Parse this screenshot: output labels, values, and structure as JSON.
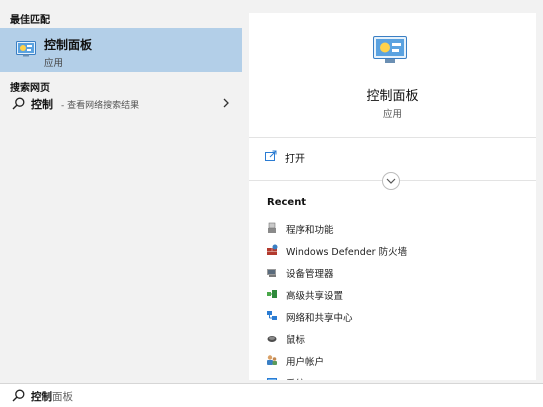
{
  "left": {
    "best_match_heading": "最佳匹配",
    "best_match": {
      "title": "控制面板",
      "subtitle": "应用",
      "icon": "control-panel-icon"
    },
    "web_search_heading": "搜索网页",
    "web_result": {
      "query": "控制",
      "hint": "- 查看网络搜索结果",
      "icon": "search-icon",
      "arrow_icon": "chevron-right-icon"
    }
  },
  "right": {
    "title": "控制面板",
    "subtitle": "应用",
    "icon": "control-panel-icon",
    "actions": [
      {
        "label": "打开",
        "icon": "open-window-icon"
      }
    ],
    "expand_icon": "chevron-down-icon",
    "recent_heading": "Recent",
    "recent_items": [
      {
        "label": "程序和功能",
        "icon": "programs-features-icon"
      },
      {
        "label": "Windows Defender 防火墙",
        "icon": "firewall-icon"
      },
      {
        "label": "设备管理器",
        "icon": "device-manager-icon"
      },
      {
        "label": "高级共享设置",
        "icon": "advanced-sharing-icon"
      },
      {
        "label": "网络和共享中心",
        "icon": "network-sharing-icon"
      },
      {
        "label": "鼠标",
        "icon": "mouse-icon"
      },
      {
        "label": "用户帐户",
        "icon": "user-accounts-icon"
      },
      {
        "label": "系统",
        "icon": "system-icon"
      }
    ]
  },
  "search_box": {
    "typed": "控制",
    "autocomplete": "面板",
    "icon": "search-icon"
  },
  "colors": {
    "selected_bg": "#b3cfe8",
    "pane_bg": "#f2f2f2",
    "card_bg": "#ffffff",
    "accent_blue": "#2b7cd3"
  }
}
